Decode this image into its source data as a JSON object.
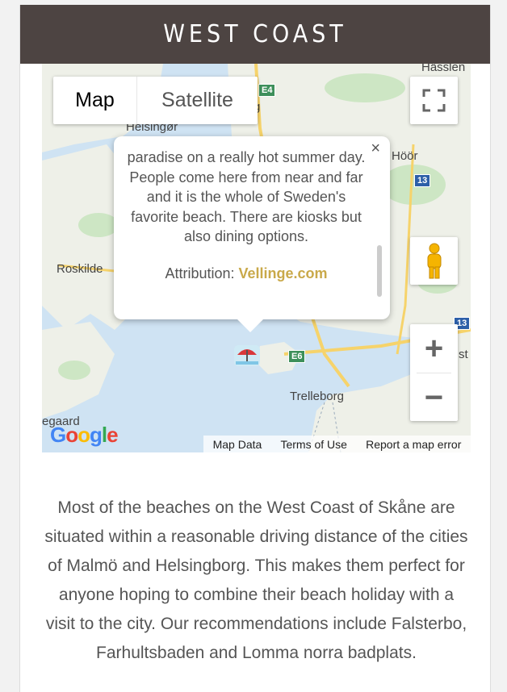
{
  "header": {
    "title": "WEST COAST"
  },
  "map": {
    "map_type": {
      "map": "Map",
      "satellite": "Satellite"
    },
    "labels": {
      "helsingor": "Helsingør",
      "hor": "Höör",
      "roskilde": "Roskilde",
      "trelleborg": "Trelleborg",
      "hassleholm": "Hässlen",
      "gaard": "egaard",
      "ng": "g",
      "st": "st"
    },
    "road_shields": {
      "e4": "E4",
      "r13a": "13",
      "r13b": "13",
      "e6": "E6"
    },
    "popup": {
      "text": "paradise on a really hot summer day. People come here from near and far and it is the whole of Sweden's favorite beach. There are kiosks but also dining options.",
      "attribution_label": "Attribution:",
      "attribution_link": "Vellinge.com",
      "close": "×"
    },
    "footer": {
      "map_data": "Map Data",
      "terms": "Terms of Use",
      "report": "Report a map error"
    },
    "logo": "Google",
    "zoom_in": "+",
    "zoom_out": "−"
  },
  "description": "Most of the beaches on the West Coast of Skåne are situated within a reasonable driving distance of the cities of Malmö and Helsingborg. This makes them perfect for anyone hoping to combine their beach holiday with a visit to the city. Our recommendations include Falsterbo, Farhultsbaden and Lomma norra badplats."
}
